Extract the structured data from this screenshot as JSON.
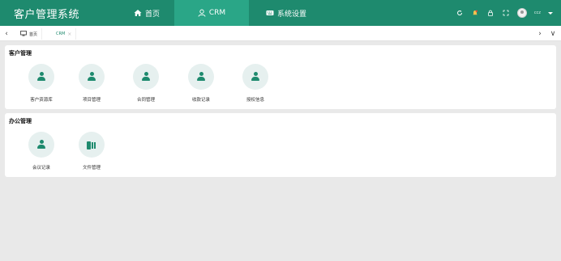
{
  "app": {
    "title": "客户管理系统"
  },
  "nav": [
    {
      "label": "首页",
      "icon": "home-icon"
    },
    {
      "label": "CRM",
      "icon": "user-outline-icon",
      "active": true
    },
    {
      "label": "系统设置",
      "icon": "keyboard-icon"
    }
  ],
  "toolbar": {
    "icons": [
      "refresh-icon",
      "notification-icon",
      "lock-icon",
      "fullscreen-icon"
    ],
    "username": "ccz"
  },
  "tabs": [
    {
      "label": "首页",
      "icon": "monitor-icon"
    },
    {
      "label": "CRM",
      "close": "×",
      "active": true
    }
  ],
  "tab_nav": {
    "left": "‹",
    "right": "›",
    "down": "∨"
  },
  "sections": [
    {
      "title": "客户管理",
      "items": [
        {
          "label": "客户资源库",
          "icon": "person-icon"
        },
        {
          "label": "项目管理",
          "icon": "person-icon"
        },
        {
          "label": "合同管理",
          "icon": "person-icon"
        },
        {
          "label": "收款记录",
          "icon": "person-icon"
        },
        {
          "label": "授权信息",
          "icon": "person-icon"
        }
      ]
    },
    {
      "title": "办公管理",
      "items": [
        {
          "label": "会议记录",
          "icon": "person-icon"
        },
        {
          "label": "文件管理",
          "icon": "file-icon"
        }
      ]
    }
  ],
  "colors": {
    "primary": "#1e8a6e",
    "active_nav": "#2aa687",
    "icon_bg": "#e6f0ef",
    "background": "#e9e9e9"
  }
}
